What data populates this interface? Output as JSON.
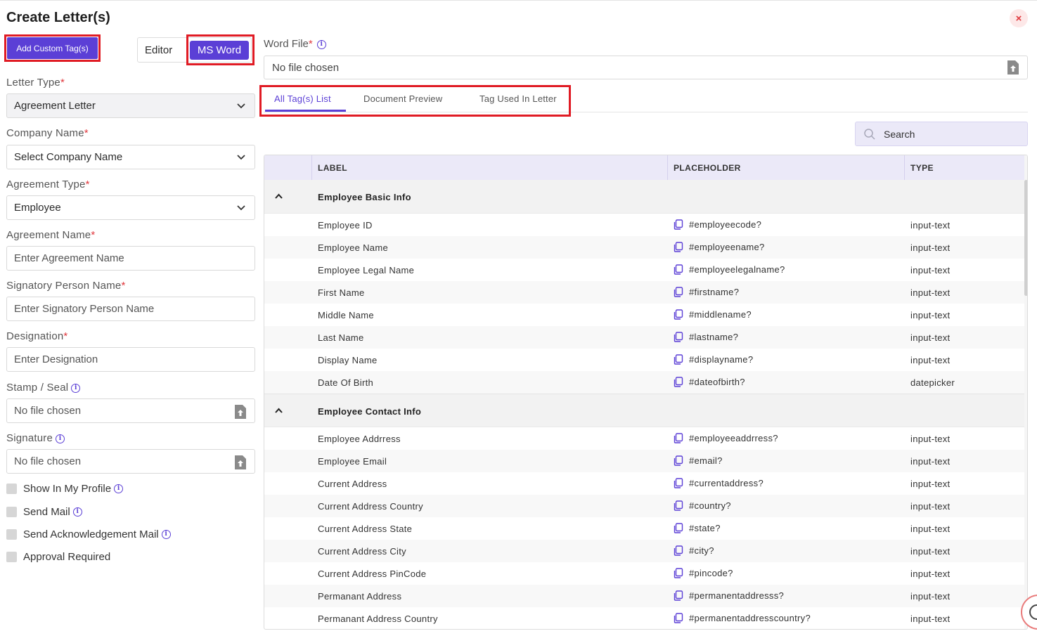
{
  "modal": {
    "title": "Create Letter(s)",
    "close": "×"
  },
  "left": {
    "add_custom_tags": "Add Custom Tag(s)",
    "mode_editor": "Editor",
    "mode_msword": "MS Word",
    "letter_type": {
      "label": "Letter Type",
      "value": "Agreement Letter"
    },
    "company_name": {
      "label": "Company Name",
      "value": "Select Company Name"
    },
    "agreement_type": {
      "label": "Agreement Type",
      "value": "Employee"
    },
    "agreement_name": {
      "label": "Agreement Name",
      "placeholder": "Enter Agreement Name"
    },
    "signatory": {
      "label": "Signatory Person Name",
      "placeholder": "Enter Signatory Person Name"
    },
    "designation": {
      "label": "Designation",
      "placeholder": "Enter Designation"
    },
    "stamp": {
      "label": "Stamp / Seal",
      "value": "No file chosen"
    },
    "signature": {
      "label": "Signature",
      "value": "No file chosen"
    },
    "required_mark": "*",
    "info_glyph": "i",
    "checkboxes": {
      "show_profile": "Show In My Profile",
      "send_mail": "Send Mail",
      "send_ack": "Send Acknowledgement Mail",
      "approval": "Approval Required"
    }
  },
  "right": {
    "word_file": {
      "label": "Word File",
      "value": "No file chosen"
    },
    "tabs": {
      "all_tags": "All Tag(s) List",
      "preview": "Document Preview",
      "used": "Tag Used In Letter"
    },
    "search_placeholder": "Search",
    "table": {
      "headers": {
        "label": "LABEL",
        "placeholder": "PLACEHOLDER",
        "type": "TYPE"
      },
      "group1": {
        "title": "Employee Basic Info",
        "rows": [
          {
            "label": "Employee ID",
            "placeholder": "#employeecode?",
            "type": "input-text"
          },
          {
            "label": "Employee Name",
            "placeholder": "#employeename?",
            "type": "input-text"
          },
          {
            "label": "Employee Legal Name",
            "placeholder": "#employeelegalname?",
            "type": "input-text"
          },
          {
            "label": "First Name",
            "placeholder": "#firstname?",
            "type": "input-text"
          },
          {
            "label": "Middle Name",
            "placeholder": "#middlename?",
            "type": "input-text"
          },
          {
            "label": "Last Name",
            "placeholder": "#lastname?",
            "type": "input-text"
          },
          {
            "label": "Display Name",
            "placeholder": "#displayname?",
            "type": "input-text"
          },
          {
            "label": "Date Of Birth",
            "placeholder": "#dateofbirth?",
            "type": "datepicker"
          }
        ]
      },
      "group2": {
        "title": "Employee Contact Info",
        "rows": [
          {
            "label": "Employee Addrress",
            "placeholder": "#employeeaddrress?",
            "type": "input-text"
          },
          {
            "label": "Employee Email",
            "placeholder": "#email?",
            "type": "input-text"
          },
          {
            "label": "Current Address",
            "placeholder": "#currentaddress?",
            "type": "input-text"
          },
          {
            "label": "Current Address Country",
            "placeholder": "#country?",
            "type": "input-text"
          },
          {
            "label": "Current Address State",
            "placeholder": "#state?",
            "type": "input-text"
          },
          {
            "label": "Current Address City",
            "placeholder": "#city?",
            "type": "input-text"
          },
          {
            "label": "Current Address PinCode",
            "placeholder": "#pincode?",
            "type": "input-text"
          },
          {
            "label": "Permanant Address",
            "placeholder": "#permanentaddresss?",
            "type": "input-text"
          },
          {
            "label": "Permanant Address Country",
            "placeholder": "#permanentaddresscountry?",
            "type": "input-text"
          }
        ]
      }
    }
  },
  "colors": {
    "accent": "#5b3fd6",
    "highlight": "#e01b24",
    "header_bg": "#ebe9f8"
  },
  "icons": [
    "close-icon",
    "chevron-down-icon",
    "info-icon",
    "file-upload-icon",
    "search-icon",
    "chevron-up-icon",
    "copy-icon",
    "help-icon"
  ]
}
